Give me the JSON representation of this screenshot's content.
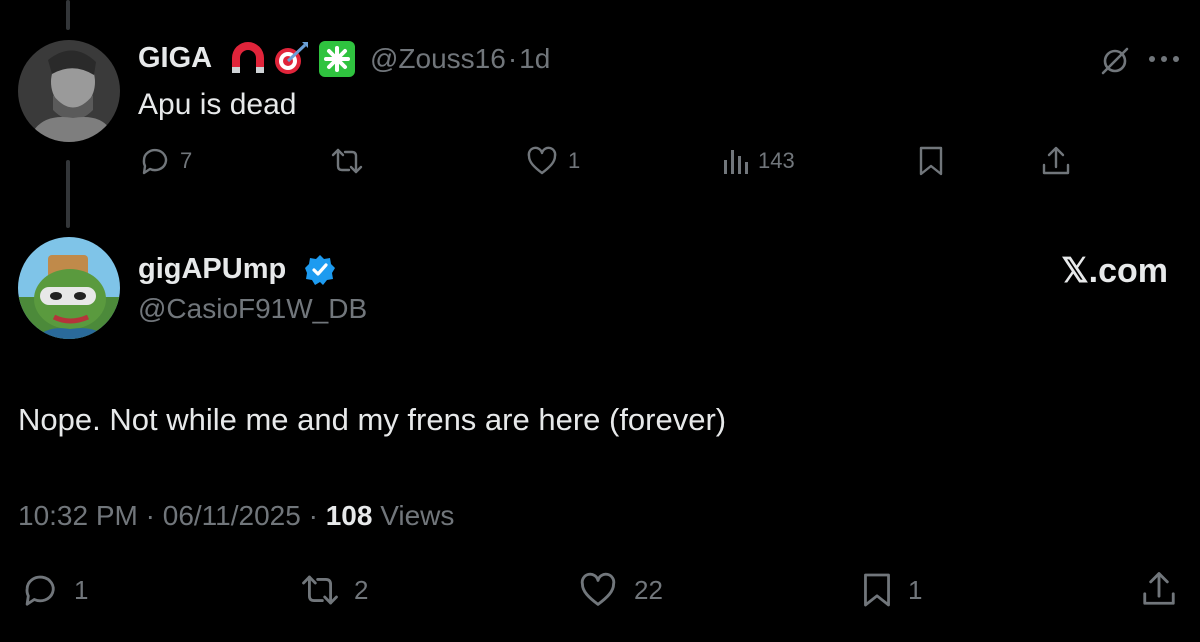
{
  "parent": {
    "display_name": "GIGA",
    "handle": "@Zouss16",
    "separator": "·",
    "time": "1d",
    "text": "Apu is dead",
    "actions": {
      "replies": "7",
      "reposts": "",
      "likes": "1",
      "views": "143"
    },
    "icons": [
      "magnet-icon",
      "target-icon",
      "sparkle-icon",
      "mute-icon",
      "more-icon"
    ]
  },
  "post": {
    "display_name": "gigAPUmp",
    "handle": "@CasioF91W_DB",
    "verified": true,
    "text": "Nope. Not while me and my frens are here (forever)",
    "time": "10:32 PM",
    "date": "06/11/2025",
    "separator": "·",
    "views_count": "108",
    "views_label": "Views",
    "actions": {
      "replies": "1",
      "reposts": "2",
      "likes": "22",
      "bookmarks": "1"
    }
  },
  "watermark": "𝕏.com",
  "colors": {
    "background": "#000000",
    "text": "#e7e9ea",
    "secondary": "#71767b",
    "verified": "#1d9bf0",
    "thread_line": "#333639"
  }
}
